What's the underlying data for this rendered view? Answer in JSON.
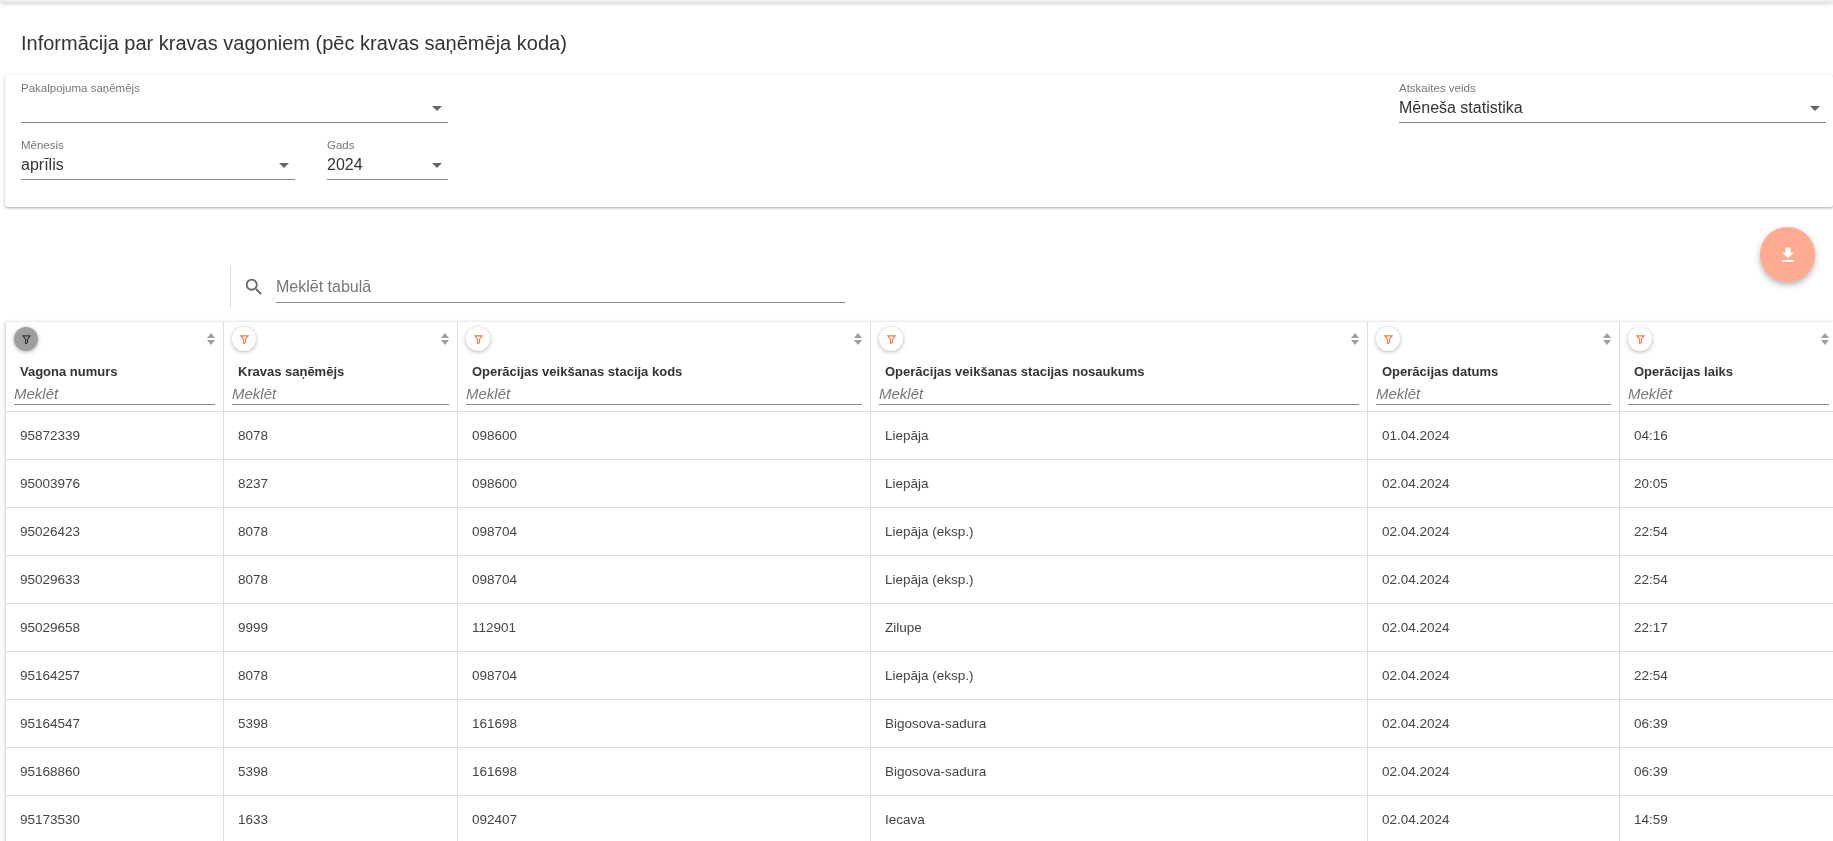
{
  "page_title": "Informācija par kravas vagoniem (pēc kravas saņēmēja koda)",
  "filters": {
    "service_recipient": {
      "label": "Pakalpojuma saņēmējs"
    },
    "report_type": {
      "label": "Atskaites veids",
      "value": "Mēneša statistika"
    },
    "month": {
      "label": "Mēnesis",
      "value": "aprīlis"
    },
    "year": {
      "label": "Gads",
      "value": "2024"
    }
  },
  "table_search": {
    "placeholder": "Meklēt tabulā"
  },
  "table": {
    "columns": [
      {
        "label": "Vagona numurs",
        "filter_active": true,
        "placeholder": "Meklēt"
      },
      {
        "label": "Kravas saņēmējs",
        "filter_active": false,
        "placeholder": "Meklēt"
      },
      {
        "label": "Operācijas veikšanas stacija kods",
        "filter_active": false,
        "placeholder": "Meklēt"
      },
      {
        "label": "Operācijas veikšanas stacijas nosaukums",
        "filter_active": false,
        "placeholder": "Meklēt"
      },
      {
        "label": "Operācijas datums",
        "filter_active": false,
        "placeholder": "Meklēt"
      },
      {
        "label": "Operācijas laiks",
        "filter_active": false,
        "placeholder": "Meklēt"
      }
    ],
    "rows": [
      [
        "95872339",
        "8078",
        "098600",
        "Liepāja",
        "01.04.2024",
        "04:16"
      ],
      [
        "95003976",
        "8237",
        "098600",
        "Liepāja",
        "02.04.2024",
        "20:05"
      ],
      [
        "95026423",
        "8078",
        "098704",
        "Liepāja (eksp.)",
        "02.04.2024",
        "22:54"
      ],
      [
        "95029633",
        "8078",
        "098704",
        "Liepāja (eksp.)",
        "02.04.2024",
        "22:54"
      ],
      [
        "95029658",
        "9999",
        "112901",
        "Zilupe",
        "02.04.2024",
        "22:17"
      ],
      [
        "95164257",
        "8078",
        "098704",
        "Liepāja (eksp.)",
        "02.04.2024",
        "22:54"
      ],
      [
        "95164547",
        "5398",
        "161698",
        "Bigosova-sadura",
        "02.04.2024",
        "06:39"
      ],
      [
        "95168860",
        "5398",
        "161698",
        "Bigosova-sadura",
        "02.04.2024",
        "06:39"
      ],
      [
        "95173530",
        "1633",
        "092407",
        "Iecava",
        "02.04.2024",
        "14:59"
      ]
    ]
  }
}
